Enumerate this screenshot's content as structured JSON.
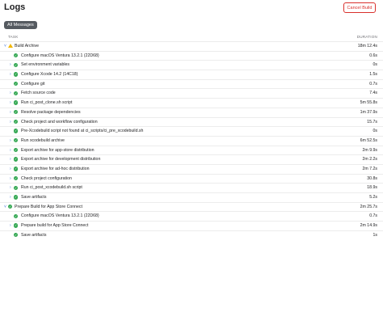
{
  "header": {
    "title": "Logs",
    "cancel_label": "Cancel Build"
  },
  "filter": {
    "label": "All Messages"
  },
  "columns": {
    "task": "TASK",
    "duration": "DURATION"
  },
  "rows": [
    {
      "level": 0,
      "chevron": "down",
      "status": "warning",
      "label": "Build Archive",
      "duration": "18m 12.4s"
    },
    {
      "level": 1,
      "chevron": "",
      "status": "success",
      "label": "Configure macOS Ventura 13.2.1 (22D68)",
      "duration": "0.6s"
    },
    {
      "level": 1,
      "chevron": "right",
      "status": "success",
      "label": "Set environment variables",
      "duration": "0s"
    },
    {
      "level": 1,
      "chevron": "right",
      "status": "success",
      "label": "Configure Xcode 14.2 (14C18)",
      "duration": "1.5s"
    },
    {
      "level": 1,
      "chevron": "",
      "status": "success",
      "label": "Configure git",
      "duration": "0.7s"
    },
    {
      "level": 1,
      "chevron": "right",
      "status": "success",
      "label": "Fetch source code",
      "duration": "7.4s"
    },
    {
      "level": 1,
      "chevron": "right",
      "status": "success",
      "label": "Run ci_post_clone.sh script",
      "duration": "5m 55.8s"
    },
    {
      "level": 1,
      "chevron": "right",
      "status": "success",
      "label": "Resolve package dependencies",
      "duration": "1m 37.9s"
    },
    {
      "level": 1,
      "chevron": "right",
      "status": "success",
      "label": "Check project and workflow configuration",
      "duration": "15.7s"
    },
    {
      "level": 1,
      "chevron": "",
      "status": "success",
      "label": "Pre-Xcodebuild script not found at ci_scripts/ci_pre_xcodebuild.sh",
      "duration": "0s"
    },
    {
      "level": 1,
      "chevron": "right",
      "status": "success",
      "label": "Run xcodebuild archive",
      "duration": "6m 52.5s"
    },
    {
      "level": 1,
      "chevron": "right",
      "status": "success",
      "label": "Export archive for app-store distribution",
      "duration": "2m 9.9s"
    },
    {
      "level": 1,
      "chevron": "right",
      "status": "success",
      "label": "Export archive for development distribution",
      "duration": "2m 2.2s"
    },
    {
      "level": 1,
      "chevron": "right",
      "status": "success",
      "label": "Export archive for ad-hoc distribution",
      "duration": "2m 7.2s"
    },
    {
      "level": 1,
      "chevron": "right",
      "status": "success",
      "label": "Check project configuration",
      "duration": "30.8s"
    },
    {
      "level": 1,
      "chevron": "right",
      "status": "success",
      "label": "Run ci_post_xcodebuild.sh script",
      "duration": "18.9s"
    },
    {
      "level": 1,
      "chevron": "right",
      "status": "success",
      "label": "Save artifacts",
      "duration": "5.2s"
    },
    {
      "level": 0,
      "chevron": "down",
      "status": "success",
      "label": "Prepare Build for App Store Connect",
      "duration": "2m 25.7s"
    },
    {
      "level": 1,
      "chevron": "",
      "status": "success",
      "label": "Configure macOS Ventura 13.2.1 (22D68)",
      "duration": "0.7s"
    },
    {
      "level": 1,
      "chevron": "right",
      "status": "success",
      "label": "Prepare build for App Store Connect",
      "duration": "2m 14.9s"
    },
    {
      "level": 1,
      "chevron": "",
      "status": "success",
      "label": "Save artifacts",
      "duration": "1s"
    }
  ]
}
